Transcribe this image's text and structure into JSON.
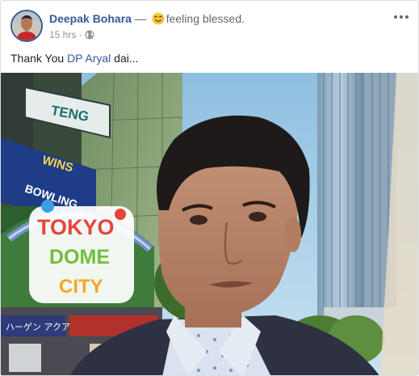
{
  "post": {
    "author": "Deepak Bohara",
    "separator": "—",
    "activity": "feeling blessed.",
    "activity_icon": "feeling-emoji-icon",
    "timestamp": "15 hrs",
    "audience_icon": "globe-icon",
    "caption_prefix": "Thank You ",
    "caption_mention": "DP Aryal",
    "caption_suffix": " dai...",
    "more_icon": "more-options-icon"
  },
  "photo": {
    "signs": {
      "teng": "TENG",
      "wins": "WINS",
      "bowling": "BOWLING",
      "tokyo": "TOKYO",
      "dome": "DOME",
      "city": "CITY",
      "bottom_sign": "ハーゲン アクア"
    }
  },
  "colors": {
    "link": "#385898",
    "meta": "#606770",
    "sky": "#a8cde6",
    "logo_red": "#e8443a",
    "logo_green": "#6fbf3a"
  }
}
